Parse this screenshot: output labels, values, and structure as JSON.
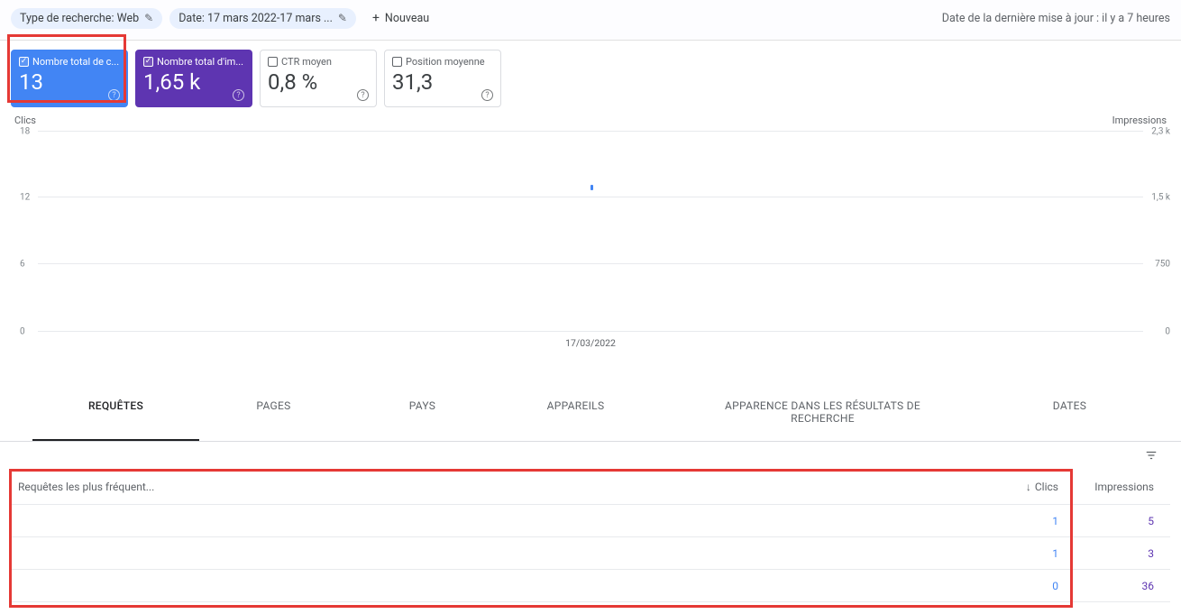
{
  "filters": {
    "search_type_label": "Type de recherche: Web",
    "date_label": "Date: 17 mars 2022-17 mars ...",
    "new_label": "Nouveau"
  },
  "last_update": "Date de la dernière mise à jour : il y a 7 heures",
  "metrics": [
    {
      "label": "Nombre total de c...",
      "value": "13",
      "checked": true
    },
    {
      "label": "Nombre total d'im...",
      "value": "1,65 k",
      "checked": true
    },
    {
      "label": "CTR moyen",
      "value": "0,8 %",
      "checked": false
    },
    {
      "label": "Position moyenne",
      "value": "31,3",
      "checked": false
    }
  ],
  "chart": {
    "left_axis": "Clics",
    "right_axis": "Impressions",
    "left_ticks": [
      "18",
      "12",
      "6",
      "0"
    ],
    "right_ticks": [
      "2,3 k",
      "1,5 k",
      "750",
      "0"
    ],
    "x_tick": "17/03/2022"
  },
  "tabs": [
    "REQUÊTES",
    "PAGES",
    "PAYS",
    "APPAREILS",
    "APPARENCE DANS LES RÉSULTATS DE RECHERCHE",
    "DATES"
  ],
  "table": {
    "header_query": "Requêtes les plus fréquent...",
    "header_clicks": "Clics",
    "header_impressions": "Impressions",
    "rows": [
      {
        "query": "",
        "clicks": "1",
        "impressions": "5"
      },
      {
        "query": "",
        "clicks": "1",
        "impressions": "3"
      },
      {
        "query": "",
        "clicks": "0",
        "impressions": "36"
      }
    ]
  },
  "chart_data": {
    "type": "line",
    "x": [
      "17/03/2022"
    ],
    "series": [
      {
        "name": "Clics",
        "values": [
          13
        ]
      },
      {
        "name": "Impressions",
        "values": [
          1650
        ]
      }
    ],
    "xlabel": "",
    "y_left_label": "Clics",
    "y_right_label": "Impressions",
    "y_left_range": [
      0,
      18
    ],
    "y_right_range": [
      0,
      2300
    ]
  }
}
